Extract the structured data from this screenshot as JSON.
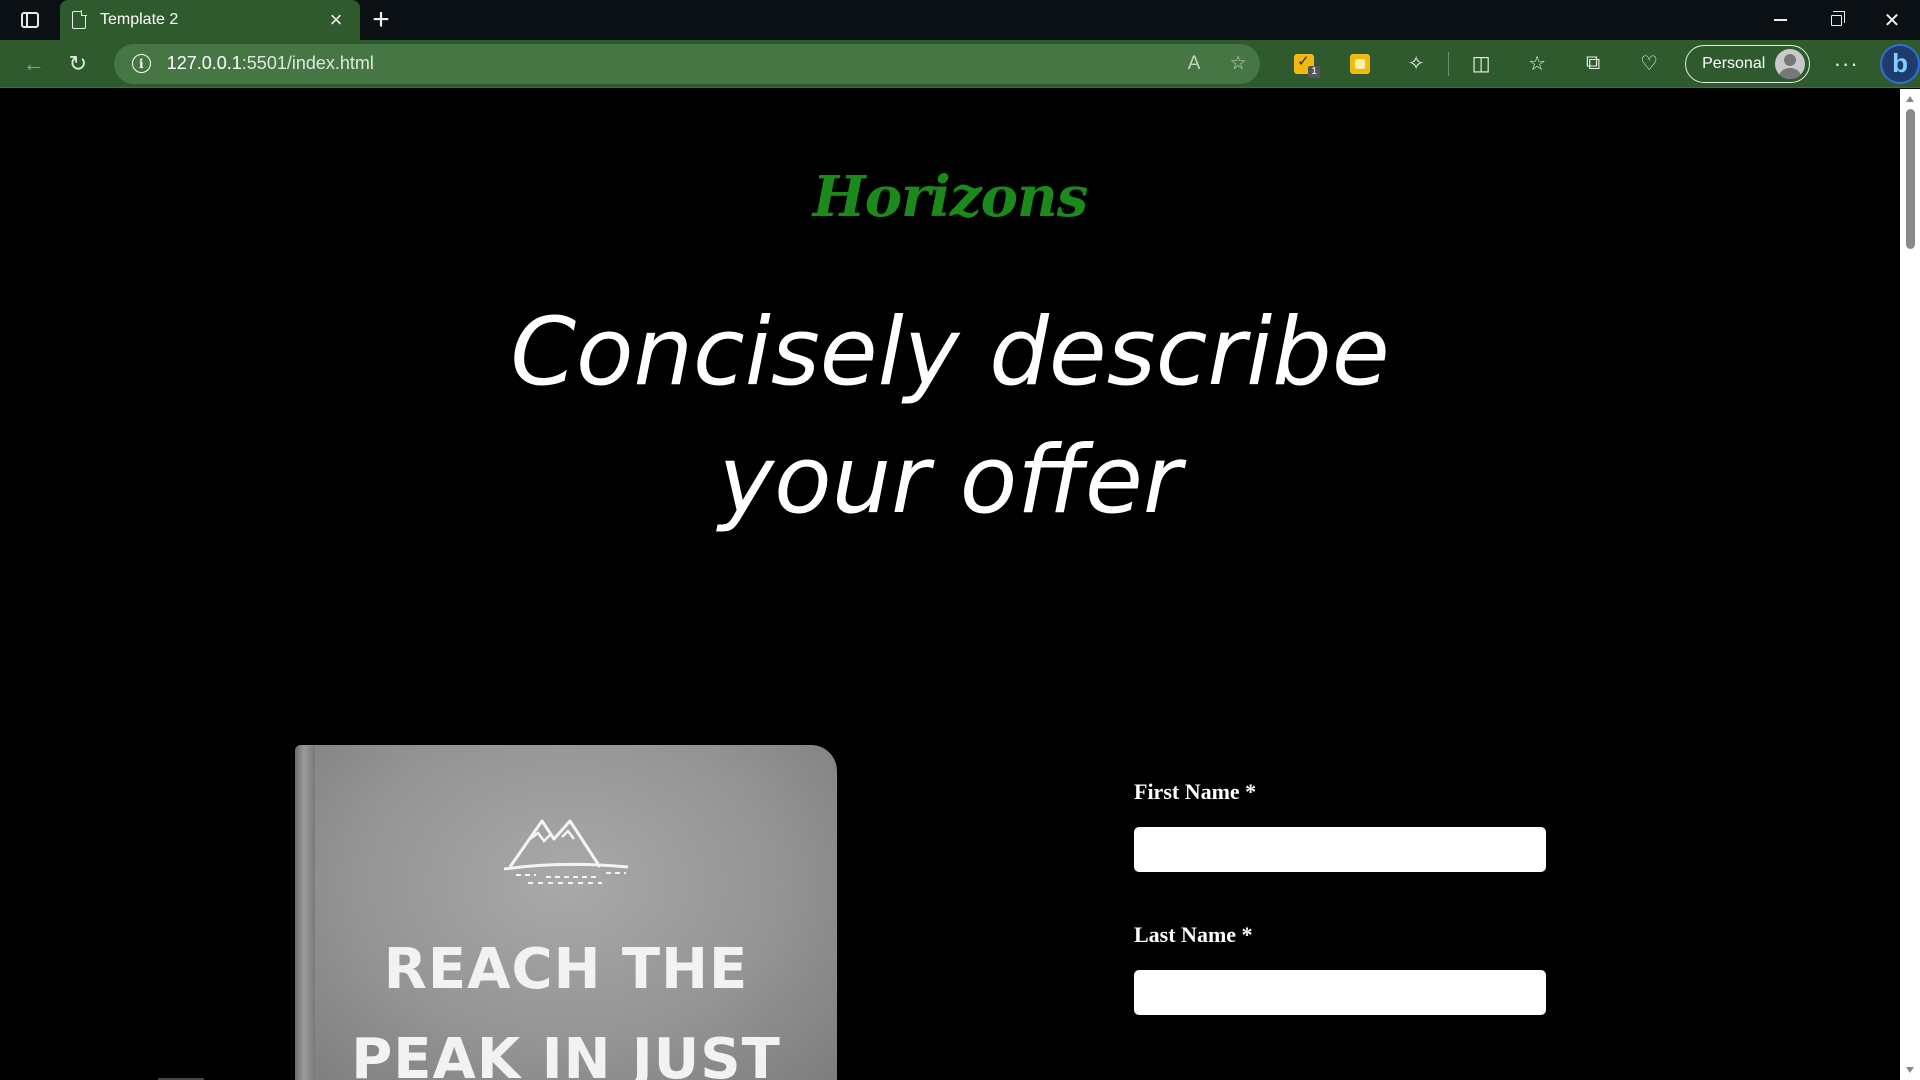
{
  "browser": {
    "tab_title": "Template 2",
    "new_tab_symbol": "+",
    "url_host": "127.0.0.1",
    "url_path": ":5501/index.html",
    "profile_label": "Personal",
    "badge_count": "1"
  },
  "page": {
    "logo": "Horizons",
    "headline_line1": "Concisely describe",
    "headline_line2": "your offer",
    "book_title_line1": "REACH THE",
    "book_title_line2": "PEAK IN JUST"
  },
  "form": {
    "first_name_label": "First Name *",
    "first_name_value": "",
    "last_name_label": "Last Name *",
    "last_name_value": ""
  },
  "colors": {
    "tab_active": "#2f5a2e",
    "logo_green": "#1b8a1b",
    "page_background": "#000000"
  },
  "icons": [
    "tab-actions-icon",
    "page-icon",
    "close-icon",
    "plus-icon",
    "minimize-icon",
    "restore-icon",
    "back-arrow-icon",
    "refresh-icon",
    "info-icon",
    "read-aloud-icon",
    "favorite-star-icon",
    "extension-check-icon",
    "sticky-notes-icon",
    "extensions-puzzle-icon",
    "split-screen-icon",
    "favorites-icon",
    "collections-icon",
    "browser-essentials-icon",
    "more-icon",
    "bing-icon",
    "mountain-logo-icon"
  ]
}
